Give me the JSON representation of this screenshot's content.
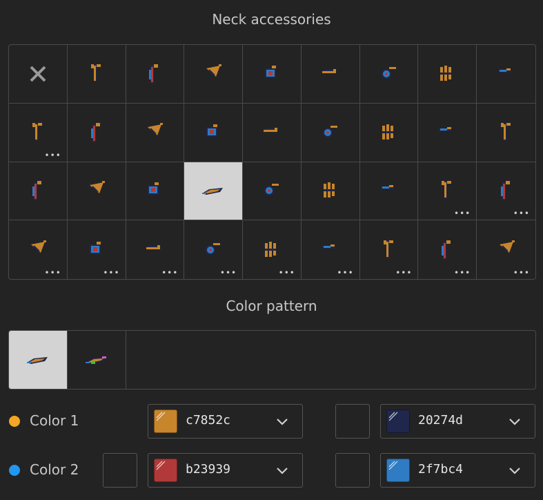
{
  "neck_accessories": {
    "title": "Neck accessories",
    "items": [
      {
        "name": "none",
        "icon": "close-icon",
        "selected": false,
        "has_more": false
      },
      {
        "name": "acc-1",
        "icon": "accessory-sprite",
        "selected": false,
        "has_more": false
      },
      {
        "name": "acc-2",
        "icon": "accessory-sprite",
        "selected": false,
        "has_more": false
      },
      {
        "name": "acc-3",
        "icon": "accessory-sprite",
        "selected": false,
        "has_more": false
      },
      {
        "name": "acc-4",
        "icon": "accessory-sprite",
        "selected": false,
        "has_more": false
      },
      {
        "name": "acc-5",
        "icon": "accessory-sprite",
        "selected": false,
        "has_more": false
      },
      {
        "name": "acc-6",
        "icon": "accessory-sprite",
        "selected": false,
        "has_more": false
      },
      {
        "name": "acc-7",
        "icon": "accessory-sprite",
        "selected": false,
        "has_more": false
      },
      {
        "name": "acc-8",
        "icon": "accessory-sprite",
        "selected": false,
        "has_more": false
      },
      {
        "name": "acc-9",
        "icon": "accessory-sprite",
        "selected": false,
        "has_more": true
      },
      {
        "name": "acc-10",
        "icon": "accessory-sprite",
        "selected": false,
        "has_more": false
      },
      {
        "name": "acc-11",
        "icon": "accessory-sprite",
        "selected": false,
        "has_more": false
      },
      {
        "name": "acc-12",
        "icon": "accessory-sprite",
        "selected": false,
        "has_more": false
      },
      {
        "name": "acc-13",
        "icon": "accessory-sprite",
        "selected": false,
        "has_more": false
      },
      {
        "name": "acc-14",
        "icon": "accessory-sprite",
        "selected": false,
        "has_more": false
      },
      {
        "name": "acc-15",
        "icon": "accessory-sprite",
        "selected": false,
        "has_more": false
      },
      {
        "name": "acc-16",
        "icon": "accessory-sprite",
        "selected": false,
        "has_more": false
      },
      {
        "name": "acc-17",
        "icon": "accessory-sprite",
        "selected": false,
        "has_more": false
      },
      {
        "name": "acc-18",
        "icon": "accessory-sprite",
        "selected": false,
        "has_more": false
      },
      {
        "name": "acc-19",
        "icon": "accessory-sprite",
        "selected": false,
        "has_more": false
      },
      {
        "name": "acc-20",
        "icon": "accessory-sprite",
        "selected": false,
        "has_more": false
      },
      {
        "name": "acc-21",
        "icon": "accessory-sprite",
        "selected": true,
        "has_more": false
      },
      {
        "name": "acc-22",
        "icon": "accessory-sprite",
        "selected": false,
        "has_more": false
      },
      {
        "name": "acc-23",
        "icon": "accessory-sprite",
        "selected": false,
        "has_more": false
      },
      {
        "name": "acc-24",
        "icon": "accessory-sprite",
        "selected": false,
        "has_more": false
      },
      {
        "name": "acc-25",
        "icon": "accessory-sprite",
        "selected": false,
        "has_more": true
      },
      {
        "name": "acc-26",
        "icon": "accessory-sprite",
        "selected": false,
        "has_more": true
      },
      {
        "name": "acc-27",
        "icon": "accessory-sprite",
        "selected": false,
        "has_more": true
      },
      {
        "name": "acc-28",
        "icon": "accessory-sprite",
        "selected": false,
        "has_more": true
      },
      {
        "name": "acc-29",
        "icon": "accessory-sprite",
        "selected": false,
        "has_more": true
      },
      {
        "name": "acc-30",
        "icon": "accessory-sprite",
        "selected": false,
        "has_more": true
      },
      {
        "name": "acc-31",
        "icon": "accessory-sprite",
        "selected": false,
        "has_more": true
      },
      {
        "name": "acc-32",
        "icon": "accessory-sprite",
        "selected": false,
        "has_more": true
      },
      {
        "name": "acc-33",
        "icon": "accessory-sprite",
        "selected": false,
        "has_more": true
      },
      {
        "name": "acc-34",
        "icon": "accessory-sprite",
        "selected": false,
        "has_more": true
      },
      {
        "name": "acc-35",
        "icon": "accessory-sprite",
        "selected": false,
        "has_more": true
      }
    ],
    "more_label": "•••"
  },
  "color_pattern": {
    "title": "Color pattern",
    "patterns": [
      {
        "name": "pattern-1",
        "selected": true
      },
      {
        "name": "pattern-2",
        "selected": false
      }
    ]
  },
  "colors": [
    {
      "label": "Color 1",
      "dot_color": "#f5a623",
      "left_empty_swatch": false,
      "primary": {
        "hex": "c7852c",
        "swatch": "#c7852c"
      },
      "right_empty_swatch": true,
      "secondary": {
        "hex": "20274d",
        "swatch": "#20274d"
      }
    },
    {
      "label": "Color 2",
      "dot_color": "#2196f3",
      "left_empty_swatch": true,
      "primary": {
        "hex": "b23939",
        "swatch": "#b23939"
      },
      "right_empty_swatch": true,
      "secondary": {
        "hex": "2f7bc4",
        "swatch": "#2f7bc4"
      }
    }
  ],
  "palette": {
    "orange": "#c7852c",
    "navy": "#20274d",
    "red": "#b23939",
    "blue": "#2f7bc4"
  }
}
